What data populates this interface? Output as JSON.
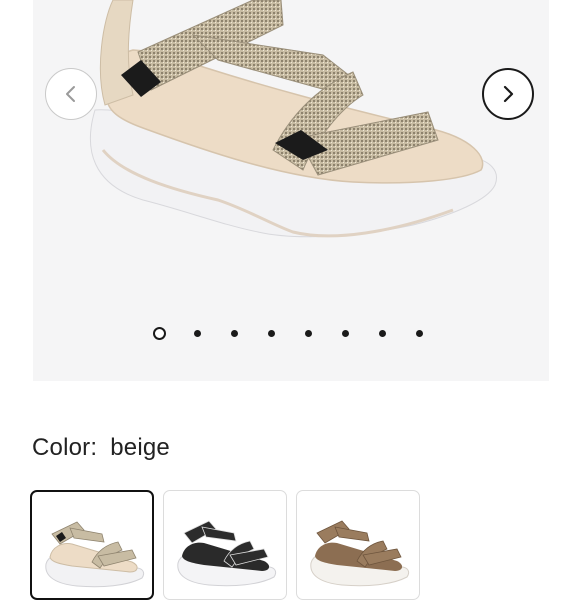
{
  "product": {
    "color_label": "Color:",
    "color_value": "beige"
  },
  "gallery": {
    "image_count": 8,
    "active_index": 0,
    "prev_icon": "chevron-left-icon",
    "next_icon": "chevron-right-icon"
  },
  "swatches": [
    {
      "color": "beige",
      "selected": true
    },
    {
      "color": "black",
      "selected": false
    },
    {
      "color": "brown",
      "selected": false
    }
  ],
  "colors": {
    "gallery_bg": "#f5f5f6",
    "strap_beige": "#c9bfa8",
    "footbed_beige": "#eddcc6",
    "sole_white": "#f2f2f4",
    "outline": "#1a1a1a"
  }
}
